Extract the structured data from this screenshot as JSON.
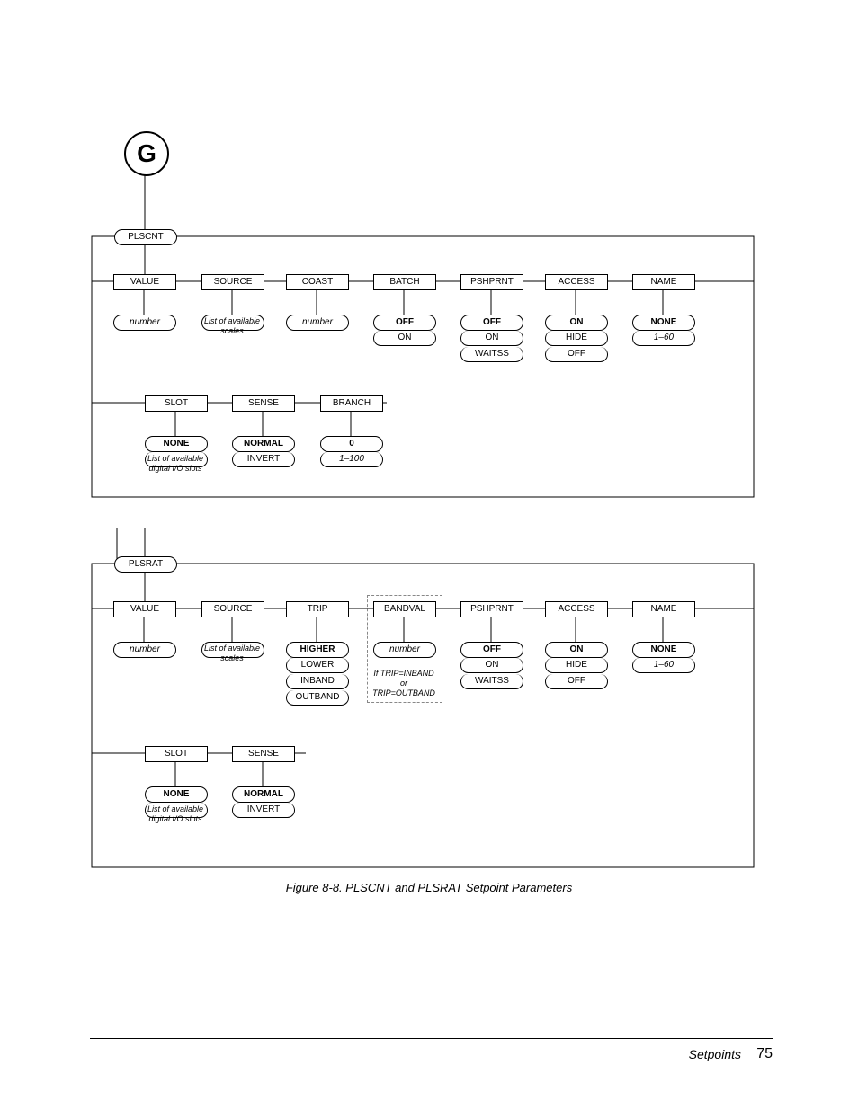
{
  "start": {
    "label": "G"
  },
  "plscnt": {
    "title": "PLSCNT",
    "row1": {
      "value": {
        "head": "VALUE",
        "opts": [
          "number"
        ],
        "note": ""
      },
      "source": {
        "head": "SOURCE",
        "opts": [],
        "note": "List of available scales"
      },
      "coast": {
        "head": "COAST",
        "opts": [
          "number"
        ]
      },
      "batch": {
        "head": "BATCH",
        "opts": [
          "OFF",
          "ON"
        ]
      },
      "pshprnt": {
        "head": "PSHPRNT",
        "opts": [
          "OFF",
          "ON",
          "WAITSS"
        ]
      },
      "access": {
        "head": "ACCESS",
        "opts": [
          "ON",
          "HIDE",
          "OFF"
        ]
      },
      "name": {
        "head": "NAME",
        "opts": [
          "NONE",
          "1–60"
        ]
      }
    },
    "row2": {
      "slot": {
        "head": "SLOT",
        "opts": [
          "NONE"
        ],
        "note": "List of available digital I/O slots"
      },
      "sense": {
        "head": "SENSE",
        "opts": [
          "NORMAL",
          "INVERT"
        ]
      },
      "branch": {
        "head": "BRANCH",
        "opts": [
          "0",
          "1–100"
        ]
      }
    }
  },
  "plsrat": {
    "title": "PLSRAT",
    "row1": {
      "value": {
        "head": "VALUE",
        "opts": [
          "number"
        ]
      },
      "source": {
        "head": "SOURCE",
        "opts": [],
        "note": "List of available scales"
      },
      "trip": {
        "head": "TRIP",
        "opts": [
          "HIGHER",
          "LOWER",
          "INBAND",
          "OUTBAND"
        ]
      },
      "bandval": {
        "head": "BANDVAL",
        "opts": [
          "number"
        ],
        "note_lines": [
          "If TRIP=INBAND",
          "or",
          "TRIP=OUTBAND"
        ]
      },
      "pshprnt": {
        "head": "PSHPRNT",
        "opts": [
          "OFF",
          "ON",
          "WAITSS"
        ]
      },
      "access": {
        "head": "ACCESS",
        "opts": [
          "ON",
          "HIDE",
          "OFF"
        ]
      },
      "name": {
        "head": "NAME",
        "opts": [
          "NONE",
          "1–60"
        ]
      }
    },
    "row2": {
      "slot": {
        "head": "SLOT",
        "opts": [
          "NONE"
        ],
        "note": "List of available digital I/O slots"
      },
      "sense": {
        "head": "SENSE",
        "opts": [
          "NORMAL",
          "INVERT"
        ]
      }
    }
  },
  "caption": "Figure 8-8. PLSCNT and PLSRAT Setpoint Parameters",
  "footer": {
    "section": "Setpoints",
    "page": "75"
  }
}
